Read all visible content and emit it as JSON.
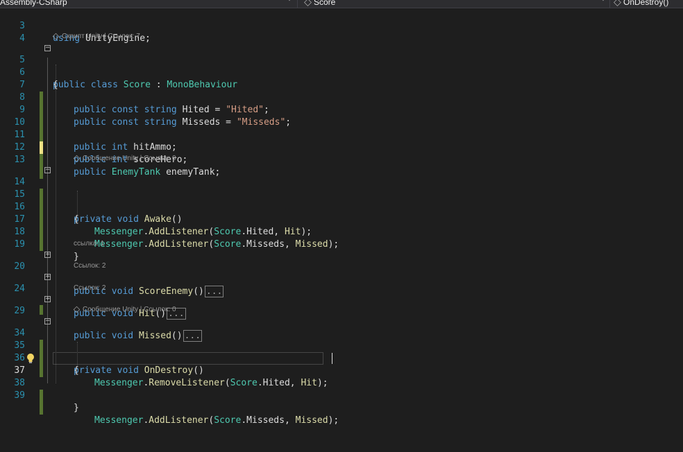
{
  "toolbar": {
    "project_dropdown": "Assembly-CSharp",
    "class_dropdown": "Score",
    "member_dropdown": "OnDestroy()",
    "class_icon": "class-icon",
    "member_icon": "method-icon"
  },
  "colors": {
    "background": "#1e1e1e",
    "line_number": "#2b91af",
    "keyword": "#569cd6",
    "type": "#4ec9b0",
    "string": "#d69d85",
    "method": "#dcdcaa",
    "text": "#dcdcdc",
    "change_saved": "#577430",
    "change_unsaved": "#efe285"
  },
  "code_lens": {
    "class": "Скрипт Unity | Ссылок: 7",
    "awake": "Сообщение Unity | Ссылок: 0",
    "score_enemy": "ссылка: 1",
    "hit": "Ссылок: 2",
    "missed": "Ссылок: 2",
    "on_destroy": "Сообщение Unity | Ссылок: 0"
  },
  "lines": [
    {
      "n": "3",
      "code": "using UnityEngine;"
    },
    {
      "n": "4",
      "code": ""
    },
    {
      "n": "5",
      "code": "public class Score : MonoBehaviour"
    },
    {
      "n": "6",
      "code": "{"
    },
    {
      "n": "7",
      "code": "    public const string Hited = \"Hited\";"
    },
    {
      "n": "8",
      "code": "    public const string Misseds = \"Misseds\";"
    },
    {
      "n": "9",
      "code": ""
    },
    {
      "n": "10",
      "code": "    public int hitAmmo;"
    },
    {
      "n": "11",
      "code": "    public int scoreHero;"
    },
    {
      "n": "12",
      "code": "    public EnemyTank enemyTank;"
    },
    {
      "n": "13",
      "code": ""
    },
    {
      "n": "14",
      "code": "    private void Awake()"
    },
    {
      "n": "15",
      "code": "    {"
    },
    {
      "n": "16",
      "code": "        Messenger.AddListener(Score.Hited, Hit);"
    },
    {
      "n": "17",
      "code": "        Messenger.AddListener(Score.Misseds, Missed);"
    },
    {
      "n": "18",
      "code": "    }"
    },
    {
      "n": "19",
      "code": ""
    },
    {
      "n": "20",
      "code": "    public void ScoreEnemy()..."
    },
    {
      "n": "24",
      "code": "    public void Hit()..."
    },
    {
      "n": "29",
      "code": "    public void Missed()..."
    },
    {
      "n": "34",
      "code": "    private void OnDestroy()"
    },
    {
      "n": "35",
      "code": "    {"
    },
    {
      "n": "36",
      "code": "        Messenger.RemoveListener(Score.Hited, Hit);"
    },
    {
      "n": "37",
      "code": "        Messenger.AddListener(Score.Misseds, Missed);"
    },
    {
      "n": "38",
      "code": "    }"
    },
    {
      "n": "39",
      "code": ""
    }
  ],
  "tokens": {
    "using": "using",
    "public": "public",
    "private": "private",
    "class": "class",
    "const": "const",
    "string": "string",
    "int": "int",
    "void": "void",
    "unity_engine": "UnityEngine;",
    "score": "Score",
    "colon": " : ",
    "mono": "MonoBehaviour",
    "open_brace": "{",
    "close_brace": "}",
    "hited_decl": "Hited = ",
    "hited_str": "\"Hited\"",
    "semi": ";",
    "misseds_decl": "Misseds = ",
    "misseds_str": "\"Misseds\"",
    "hit_ammo": "hitAmmo;",
    "score_hero": "scoreHero;",
    "enemy_tank_type": "EnemyTank",
    "enemy_tank": "enemyTank;",
    "awake": "Awake",
    "parens": "()",
    "messenger": "Messenger",
    "dot": ".",
    "add_listener": "AddListener",
    "remove_listener": "RemoveListener",
    "open_paren": "(",
    "hited_arg": ".Hited, ",
    "misseds_arg": ".Misseds, ",
    "hit_end": "Hit",
    "missed_end": "Missed",
    "close_paren_semi": ");",
    "score_enemy": "ScoreEnemy",
    "hit_method": "Hit",
    "missed_method": "Missed",
    "on_destroy": "OnDestroy",
    "ellipsis": "..."
  }
}
